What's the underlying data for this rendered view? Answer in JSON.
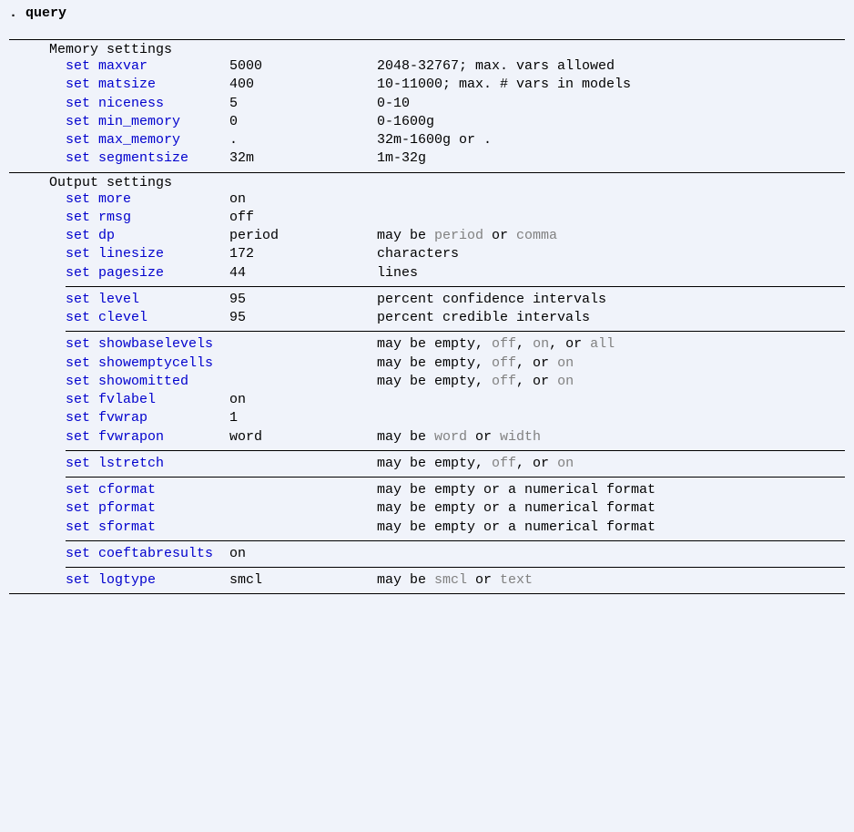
{
  "prompt": ". ",
  "command": "query",
  "set_keyword": "set",
  "sections": {
    "memory": {
      "title": "Memory settings",
      "rows": [
        {
          "name": "maxvar",
          "val": "5000",
          "desc": "2048-32767; max. vars allowed"
        },
        {
          "name": "matsize",
          "val": "400",
          "desc": "10-11000; max. # vars in models"
        },
        {
          "name": "niceness",
          "val": "5",
          "desc": "0-10"
        },
        {
          "name": "min_memory",
          "val": "0",
          "desc": "0-1600g"
        },
        {
          "name": "max_memory",
          "val": ".",
          "desc": "32m-1600g or ."
        },
        {
          "name": "segmentsize",
          "val": "32m",
          "desc": "1m-32g"
        }
      ]
    },
    "output": {
      "title": "Output settings",
      "rows1": [
        {
          "name": "more",
          "val": "on",
          "desc": ""
        },
        {
          "name": "rmsg",
          "val": "off",
          "desc": ""
        }
      ],
      "dp": {
        "name": "dp",
        "val": "period",
        "pre": "may be ",
        "opt1": "period",
        "mid": " or ",
        "opt2": "comma"
      },
      "linesize": {
        "name": "linesize",
        "val": "172",
        "desc": "characters"
      },
      "pagesize": {
        "name": "pagesize",
        "val": "44",
        "desc": "lines"
      },
      "level": {
        "name": "level",
        "val": "95",
        "desc": "percent confidence intervals"
      },
      "clevel": {
        "name": "clevel",
        "val": "95",
        "desc": "percent credible intervals"
      },
      "showbaselevels": {
        "name": "showbaselevels",
        "val": "",
        "pre": "may be empty, ",
        "w1": "off",
        "s1": ", ",
        "w2": "on",
        "s2": ", or ",
        "w3": "all"
      },
      "showemptycells": {
        "name": "showemptycells",
        "val": "",
        "pre": "may be empty, ",
        "w1": "off",
        "s1": ", or ",
        "w2": "on"
      },
      "showomitted": {
        "name": "showomitted",
        "val": "",
        "pre": "may be empty, ",
        "w1": "off",
        "s1": ", or ",
        "w2": "on"
      },
      "fvlabel": {
        "name": "fvlabel",
        "val": "on",
        "desc": ""
      },
      "fvwrap": {
        "name": "fvwrap",
        "val": "1",
        "desc": ""
      },
      "fvwrapon": {
        "name": "fvwrapon",
        "val": "word",
        "pre": "may be ",
        "w1": "word",
        "s1": " or ",
        "w2": "width"
      },
      "lstretch": {
        "name": "lstretch",
        "val": "",
        "pre": "may be empty, ",
        "w1": "off",
        "s1": ", or ",
        "w2": "on"
      },
      "cformat": {
        "name": "cformat",
        "val": "",
        "desc": "may be empty or a numerical format"
      },
      "pformat": {
        "name": "pformat",
        "val": "",
        "desc": "may be empty or a numerical format"
      },
      "sformat": {
        "name": "sformat",
        "val": "",
        "desc": "may be empty or a numerical format"
      },
      "coeftabresults": {
        "name": "coeftabresults",
        "val": "on",
        "desc": ""
      },
      "logtype": {
        "name": "logtype",
        "val": "smcl",
        "pre": "may be ",
        "w1": "smcl",
        "s1": " or ",
        "w2": "text"
      }
    }
  }
}
